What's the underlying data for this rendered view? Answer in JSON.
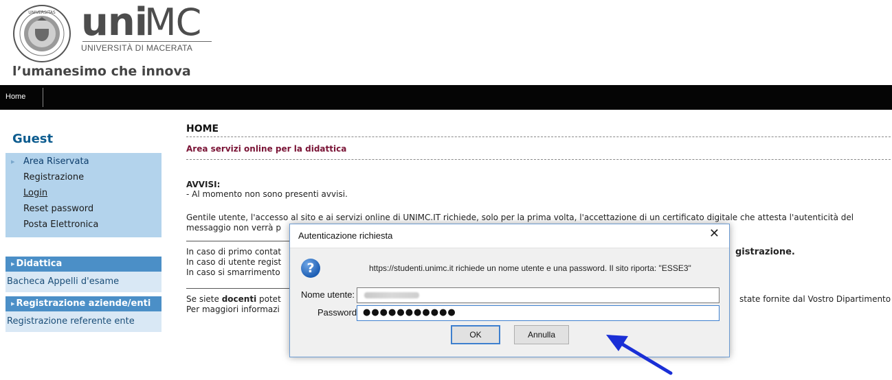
{
  "header": {
    "brand_uni": "uni",
    "brand_mc": "MC",
    "brand_sub": "UNIVERSITÀ DI MACERATA",
    "tagline": "l’umanesimo che innova",
    "nav_home": "Home"
  },
  "sidebar": {
    "title": "Guest",
    "items": [
      {
        "label": "Area Riservata"
      },
      {
        "label": "Registrazione"
      },
      {
        "label": "Login"
      },
      {
        "label": "Reset password"
      },
      {
        "label": "Posta Elettronica"
      }
    ],
    "sections": [
      {
        "header": "Didattica",
        "item": "Bacheca Appelli d'esame"
      },
      {
        "header": "Registrazione aziende/enti",
        "item": "Registrazione referente ente"
      }
    ]
  },
  "main": {
    "title": "HOME",
    "subtitle": "Area servizi online per la didattica",
    "avvisi_label": "AVVISI",
    "avvisi_text": "- Al momento non sono presenti avvisi.",
    "p1_line1": "Gentile utente, l'accesso al sito e ai servizi online di UNIMC.IT richiede, solo per la prima volta, l'accettazione di un certificato digitale che attesta l'autenticità del",
    "p1_line2_start": "messaggio non verrà p",
    "p2_line1_start": "In caso di primo contat",
    "p2_line1_end": "gistrazione.",
    "p2_line2_start": "In caso di utente regist",
    "p2_line3_start": "In caso si smarrimento",
    "p3_line1_start": "Se siete",
    "p3_docenti": "docenti",
    "p3_line1_mid": "potet",
    "p3_line1_end": "state fornite dal Vostro Dipartimento",
    "p3_line2_start": "Per maggiori informazi"
  },
  "dialog": {
    "title": "Autenticazione richiesta",
    "close_glyph": "✕",
    "message": "https://studenti.unimc.it richiede un nome utente e una password. Il sito riporta: \"ESSE3\"",
    "username_label": "Nome utente:",
    "password_label": "Password:",
    "password_value": "●●●●●●●●●●●",
    "ok_label": "OK",
    "cancel_label": "Annulla",
    "icon": "question-icon"
  },
  "annotation": {
    "arrow_color": "#1a2fd6"
  }
}
